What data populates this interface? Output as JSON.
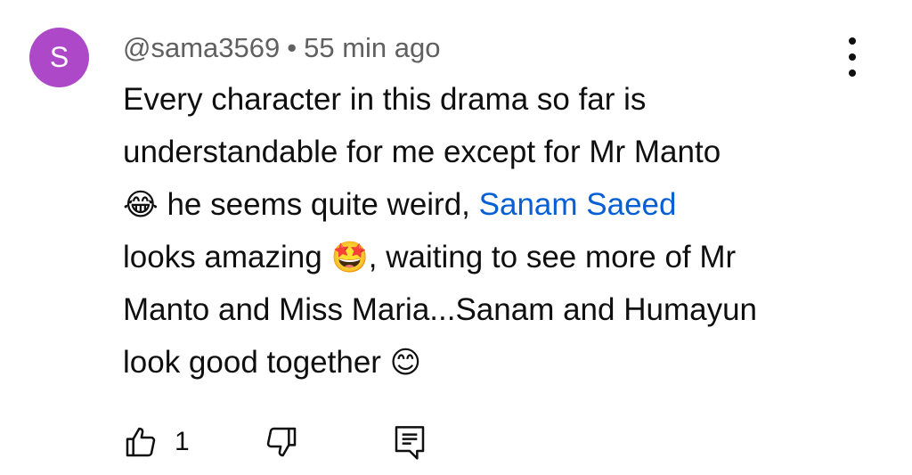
{
  "comment": {
    "avatar_letter": "S",
    "avatar_color": "#ad49c8",
    "author": "@sama3569",
    "separator": "•",
    "timestamp": "55 min ago",
    "text": {
      "line1": "Every character in this drama so far is",
      "line2": "understandable for me except for Mr Manto",
      "line3_emoji": "😂",
      "line3_text": " he seems quite weird, ",
      "mention": "Sanam Saeed",
      "line4_text": "looks amazing ",
      "line4_emoji": "🤩",
      "line4_rest": ", waiting to see more of Mr",
      "line5": "Manto and Miss Maria...Sanam and Humayun",
      "line6_text": "look good together ",
      "line6_emoji": "😊"
    },
    "mention_color": "#065fd4"
  },
  "actions": {
    "like_icon": "thumbs-up-icon",
    "like_count": "1",
    "dislike_icon": "thumbs-down-icon",
    "reply_icon": "comment-icon"
  },
  "menu_icon": "more-vertical-icon"
}
